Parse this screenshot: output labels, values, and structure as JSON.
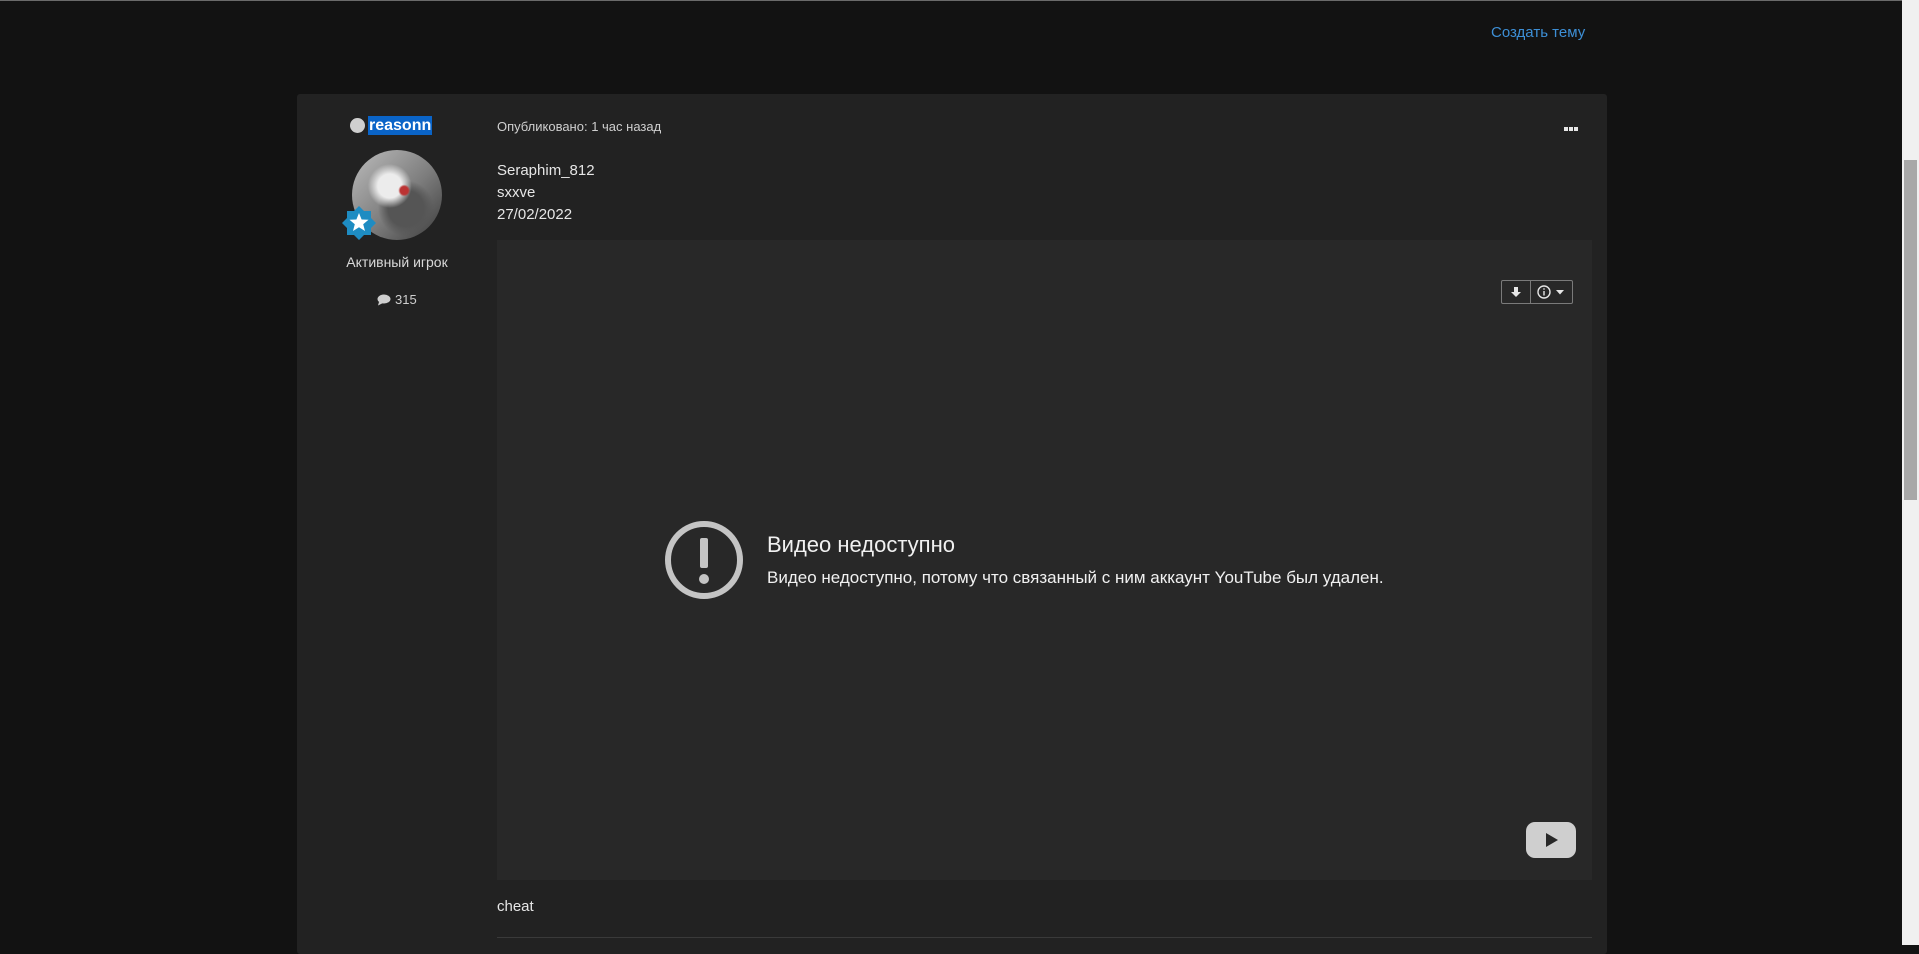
{
  "header": {
    "create_topic": "Создать тему"
  },
  "author": {
    "username": "reasonn",
    "rank": "Активный игрок",
    "post_count": "315"
  },
  "post": {
    "meta": "Опубликовано: 1 час назад",
    "lines": [
      "Seraphim_812",
      "sxxve",
      "27/02/2022"
    ],
    "after_text": "cheat"
  },
  "video": {
    "error_title": "Видео недоступно",
    "error_desc": "Видео недоступно, потому что связанный с ним аккаунт YouTube был удален."
  },
  "colors": {
    "accent": "#3d8fd6",
    "selection": "#0a64c8",
    "card": "#222222",
    "page_bg": "#121212"
  }
}
